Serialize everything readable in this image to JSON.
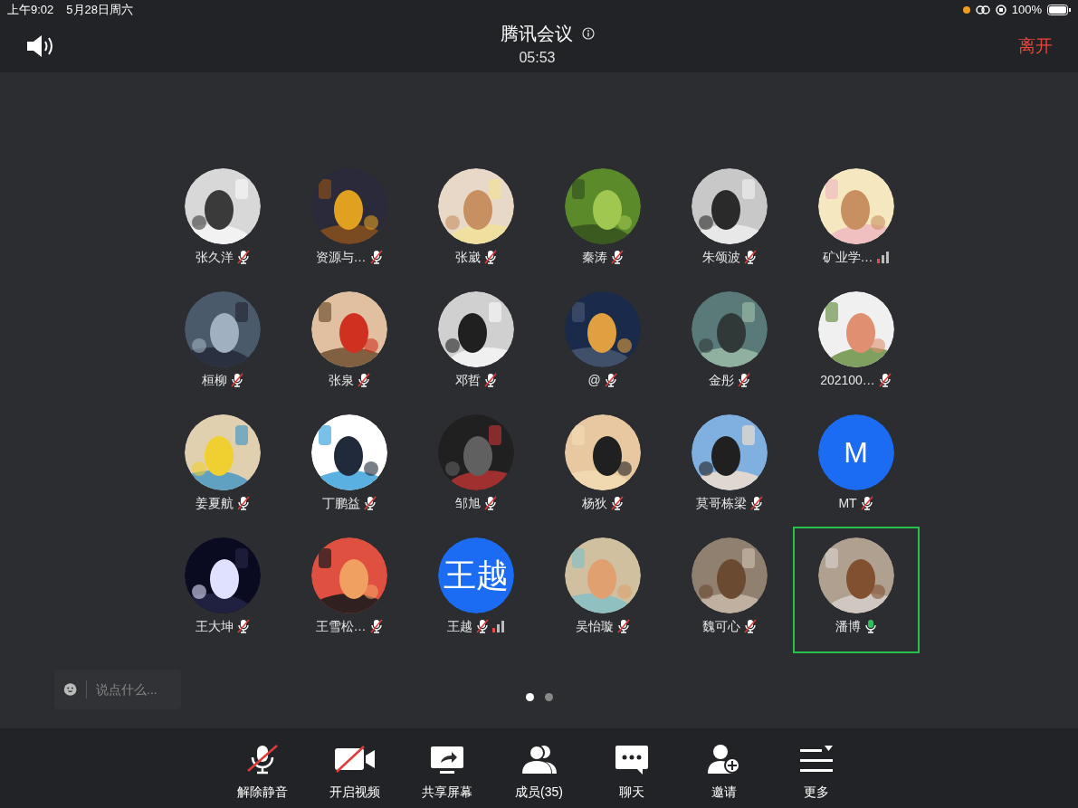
{
  "status_bar": {
    "time": "上午9:02",
    "date": "5月28日周六",
    "battery": "100%"
  },
  "header": {
    "title": "腾讯会议",
    "timer": "05:53",
    "leave": "离开"
  },
  "participants": [
    {
      "name": "张久洋",
      "kind": "picture",
      "mic_visible": true,
      "muted": true,
      "weak_signal": false,
      "selected": false
    },
    {
      "name": "资源与…",
      "kind": "picture",
      "mic_visible": true,
      "muted": true,
      "weak_signal": false,
      "selected": false
    },
    {
      "name": "张崴",
      "kind": "picture",
      "mic_visible": true,
      "muted": true,
      "weak_signal": false,
      "selected": false
    },
    {
      "name": "秦涛",
      "kind": "picture",
      "mic_visible": true,
      "muted": true,
      "weak_signal": false,
      "selected": false
    },
    {
      "name": "朱颂波",
      "kind": "picture",
      "mic_visible": true,
      "muted": true,
      "weak_signal": false,
      "selected": false
    },
    {
      "name": "矿业学…",
      "kind": "picture",
      "mic_visible": false,
      "weak_signal": true,
      "selected": false
    },
    {
      "name": "桓柳",
      "kind": "picture",
      "mic_visible": true,
      "muted": true,
      "weak_signal": false,
      "selected": false
    },
    {
      "name": "张泉",
      "kind": "picture",
      "mic_visible": true,
      "muted": true,
      "weak_signal": false,
      "selected": false
    },
    {
      "name": "邓哲",
      "kind": "picture",
      "mic_visible": true,
      "muted": true,
      "weak_signal": false,
      "selected": false
    },
    {
      "name": "@",
      "kind": "picture",
      "mic_visible": true,
      "muted": true,
      "weak_signal": false,
      "selected": false
    },
    {
      "name": "金彤",
      "kind": "picture",
      "mic_visible": true,
      "muted": true,
      "weak_signal": false,
      "selected": false
    },
    {
      "name": "202100…",
      "kind": "picture",
      "mic_visible": true,
      "muted": true,
      "weak_signal": false,
      "selected": false
    },
    {
      "name": "姜夏航",
      "kind": "picture",
      "mic_visible": true,
      "muted": true,
      "weak_signal": false,
      "selected": false
    },
    {
      "name": "丁鹏益",
      "kind": "picture",
      "mic_visible": true,
      "muted": true,
      "weak_signal": false,
      "selected": false
    },
    {
      "name": "邹旭",
      "kind": "picture",
      "mic_visible": true,
      "muted": true,
      "weak_signal": false,
      "selected": false
    },
    {
      "name": "杨狄",
      "kind": "picture",
      "mic_visible": true,
      "muted": true,
      "weak_signal": false,
      "selected": false
    },
    {
      "name": "莫哥栋梁",
      "kind": "picture",
      "mic_visible": true,
      "muted": true,
      "weak_signal": false,
      "selected": false
    },
    {
      "name": "MT",
      "kind": "letter",
      "avatar_text": "M",
      "mic_visible": true,
      "muted": true,
      "weak_signal": false,
      "selected": false
    },
    {
      "name": "王大坤",
      "kind": "picture",
      "mic_visible": true,
      "muted": true,
      "weak_signal": false,
      "selected": false
    },
    {
      "name": "王雪松…",
      "kind": "picture",
      "mic_visible": true,
      "muted": true,
      "weak_signal": false,
      "selected": false
    },
    {
      "name": "王越",
      "kind": "letter",
      "avatar_text": "王越",
      "mic_visible": true,
      "muted": true,
      "weak_signal": true,
      "selected": false
    },
    {
      "name": "吴怡璇",
      "kind": "picture",
      "mic_visible": true,
      "muted": true,
      "weak_signal": false,
      "selected": false
    },
    {
      "name": "魏可心",
      "kind": "picture",
      "mic_visible": true,
      "muted": true,
      "weak_signal": false,
      "selected": false
    },
    {
      "name": "潘博",
      "kind": "picture",
      "mic_visible": true,
      "muted": false,
      "weak_signal": false,
      "selected": true
    }
  ],
  "chat": {
    "placeholder": "说点什么..."
  },
  "pages": [
    {
      "selected": true
    },
    {
      "selected": false
    }
  ],
  "toolbar": [
    {
      "kind": "mic",
      "label": "解除静音",
      "off": true
    },
    {
      "kind": "video",
      "label": "开启视频",
      "off": true
    },
    {
      "kind": "share",
      "label": "共享屏幕"
    },
    {
      "kind": "members",
      "label": "成员(35)"
    },
    {
      "kind": "chat",
      "label": "聊天"
    },
    {
      "kind": "invite",
      "label": "邀请"
    },
    {
      "kind": "more",
      "label": "更多"
    }
  ]
}
